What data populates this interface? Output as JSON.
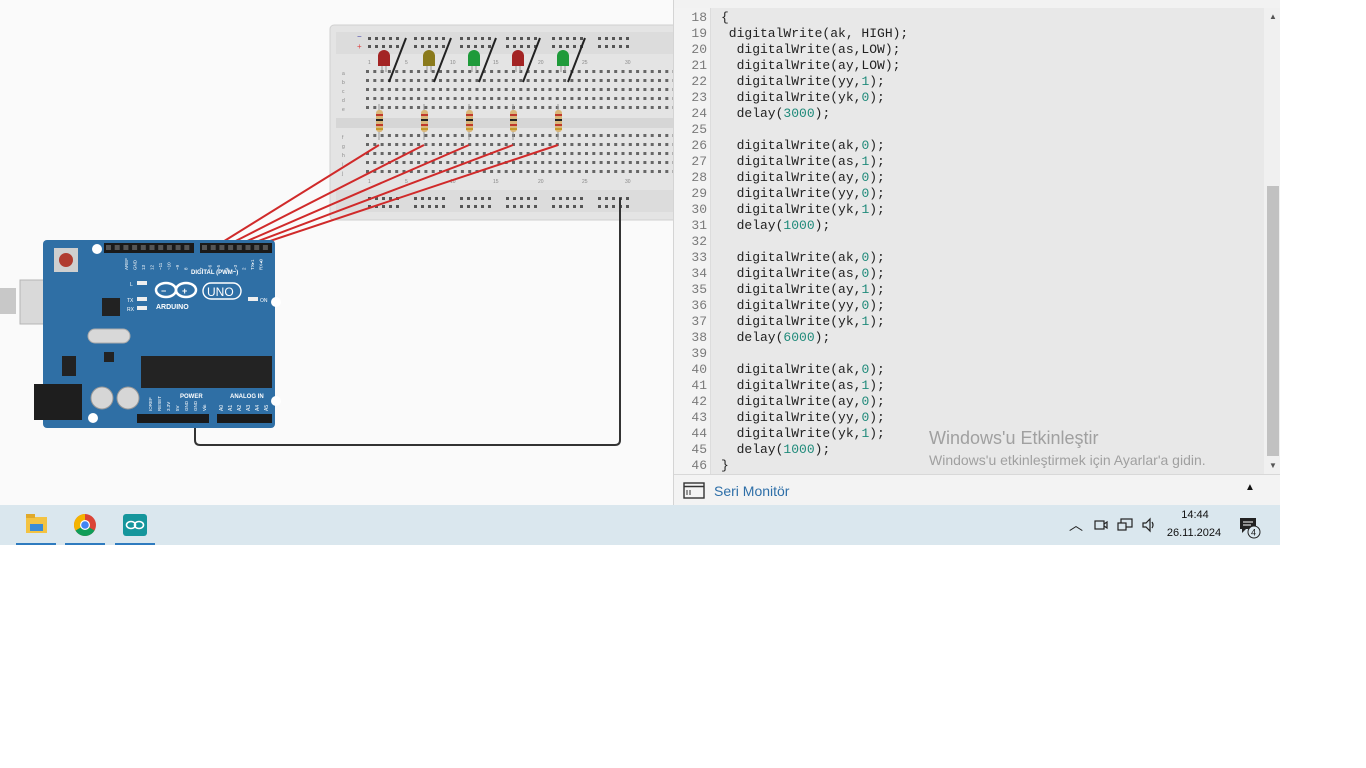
{
  "code": {
    "lines": [
      {
        "n": "18",
        "segs": [
          {
            "t": "{"
          }
        ]
      },
      {
        "n": "19",
        "segs": [
          {
            "t": " digitalWrite(ak, HIGH);"
          }
        ]
      },
      {
        "n": "20",
        "segs": [
          {
            "t": "  digitalWrite(as,LOW);"
          }
        ]
      },
      {
        "n": "21",
        "segs": [
          {
            "t": "  digitalWrite(ay,LOW);"
          }
        ]
      },
      {
        "n": "22",
        "segs": [
          {
            "t": "  digitalWrite(yy,"
          },
          {
            "t": "1",
            "c": "num"
          },
          {
            "t": ");"
          }
        ]
      },
      {
        "n": "23",
        "segs": [
          {
            "t": "  digitalWrite(yk,"
          },
          {
            "t": "0",
            "c": "num"
          },
          {
            "t": ");"
          }
        ]
      },
      {
        "n": "24",
        "segs": [
          {
            "t": "  delay("
          },
          {
            "t": "3000",
            "c": "num"
          },
          {
            "t": ");"
          }
        ]
      },
      {
        "n": "25",
        "segs": [
          {
            "t": ""
          }
        ]
      },
      {
        "n": "26",
        "segs": [
          {
            "t": "  digitalWrite(ak,"
          },
          {
            "t": "0",
            "c": "num"
          },
          {
            "t": ");"
          }
        ]
      },
      {
        "n": "27",
        "segs": [
          {
            "t": "  digitalWrite(as,"
          },
          {
            "t": "1",
            "c": "num"
          },
          {
            "t": ");"
          }
        ]
      },
      {
        "n": "28",
        "segs": [
          {
            "t": "  digitalWrite(ay,"
          },
          {
            "t": "0",
            "c": "num"
          },
          {
            "t": ");"
          }
        ]
      },
      {
        "n": "29",
        "segs": [
          {
            "t": "  digitalWrite(yy,"
          },
          {
            "t": "0",
            "c": "num"
          },
          {
            "t": ");"
          }
        ]
      },
      {
        "n": "30",
        "segs": [
          {
            "t": "  digitalWrite(yk,"
          },
          {
            "t": "1",
            "c": "num"
          },
          {
            "t": ");"
          }
        ]
      },
      {
        "n": "31",
        "segs": [
          {
            "t": "  delay("
          },
          {
            "t": "1000",
            "c": "num"
          },
          {
            "t": ");"
          }
        ]
      },
      {
        "n": "32",
        "segs": [
          {
            "t": ""
          }
        ]
      },
      {
        "n": "33",
        "segs": [
          {
            "t": "  digitalWrite(ak,"
          },
          {
            "t": "0",
            "c": "num"
          },
          {
            "t": ");"
          }
        ]
      },
      {
        "n": "34",
        "segs": [
          {
            "t": "  digitalWrite(as,"
          },
          {
            "t": "0",
            "c": "num"
          },
          {
            "t": ");"
          }
        ]
      },
      {
        "n": "35",
        "segs": [
          {
            "t": "  digitalWrite(ay,"
          },
          {
            "t": "1",
            "c": "num"
          },
          {
            "t": ");"
          }
        ]
      },
      {
        "n": "36",
        "segs": [
          {
            "t": "  digitalWrite(yy,"
          },
          {
            "t": "0",
            "c": "num"
          },
          {
            "t": ");"
          }
        ]
      },
      {
        "n": "37",
        "segs": [
          {
            "t": "  digitalWrite(yk,"
          },
          {
            "t": "1",
            "c": "num"
          },
          {
            "t": ");"
          }
        ]
      },
      {
        "n": "38",
        "segs": [
          {
            "t": "  delay("
          },
          {
            "t": "6000",
            "c": "num"
          },
          {
            "t": ");"
          }
        ]
      },
      {
        "n": "39",
        "segs": [
          {
            "t": ""
          }
        ]
      },
      {
        "n": "40",
        "segs": [
          {
            "t": "  digitalWrite(ak,"
          },
          {
            "t": "0",
            "c": "num"
          },
          {
            "t": ");"
          }
        ]
      },
      {
        "n": "41",
        "segs": [
          {
            "t": "  digitalWrite(as,"
          },
          {
            "t": "1",
            "c": "num"
          },
          {
            "t": ");"
          }
        ]
      },
      {
        "n": "42",
        "segs": [
          {
            "t": "  digitalWrite(ay,"
          },
          {
            "t": "0",
            "c": "num"
          },
          {
            "t": ");"
          }
        ]
      },
      {
        "n": "43",
        "segs": [
          {
            "t": "  digitalWrite(yy,"
          },
          {
            "t": "0",
            "c": "num"
          },
          {
            "t": ");"
          }
        ]
      },
      {
        "n": "44",
        "segs": [
          {
            "t": "  digitalWrite(yk,"
          },
          {
            "t": "1",
            "c": "num"
          },
          {
            "t": ");"
          }
        ]
      },
      {
        "n": "45",
        "segs": [
          {
            "t": "  delay("
          },
          {
            "t": "1000",
            "c": "num"
          },
          {
            "t": ");"
          }
        ]
      },
      {
        "n": "46",
        "segs": [
          {
            "t": "}"
          }
        ]
      }
    ]
  },
  "serial_monitor": {
    "label": "Seri Monitör",
    "icon": "serial-monitor-icon"
  },
  "watermark": {
    "title": "Windows'u Etkinleştir",
    "subtitle": "Windows'u etkinleştirmek için Ayarlar'a gidin."
  },
  "arduino": {
    "logo_text": "ARDUINO",
    "model": "UNO",
    "digital_label": "DIGITAL (PWM~)",
    "power_label": "POWER",
    "analog_label": "ANALOG IN",
    "on_label": "ON",
    "tx_label": "TX",
    "rx_label": "RX",
    "l_label": "L",
    "digital_pins": [
      "AREF",
      "GND",
      "13",
      "12",
      "~11",
      "~10",
      "~9",
      "8",
      "7",
      "~6",
      "~5",
      "4",
      "~3",
      "2",
      "TX▸1",
      "RX◂0"
    ],
    "power_pins": [
      "IOREF",
      "RESET",
      "3.3V",
      "5V",
      "GND",
      "GND",
      "Vin"
    ],
    "analog_pins": [
      "A0",
      "A1",
      "A2",
      "A3",
      "A4",
      "A5"
    ]
  },
  "breadboard": {
    "column_numbers": [
      "1",
      "5",
      "10",
      "15",
      "20",
      "25",
      "30"
    ],
    "rows_top": [
      "a",
      "b",
      "c",
      "d",
      "e"
    ],
    "rows_bottom": [
      "f",
      "g",
      "h",
      "i",
      "j"
    ],
    "leds": [
      "red",
      "yellow",
      "green",
      "red",
      "green"
    ],
    "colors": {
      "red": "#a32424",
      "yellow": "#8a7a1c",
      "green": "#1f9a3a",
      "wire": "#d02a2a",
      "gnd_wire": "#333333",
      "board": "#2f6fa5"
    }
  },
  "taskbar": {
    "apps": [
      {
        "name": "file-explorer",
        "icon": "folder-icon"
      },
      {
        "name": "chrome",
        "icon": "chrome-icon"
      },
      {
        "name": "arduino-ide",
        "icon": "arduino-icon"
      }
    ],
    "time": "14:44",
    "date": "26.11.2024",
    "notifications": "4"
  }
}
